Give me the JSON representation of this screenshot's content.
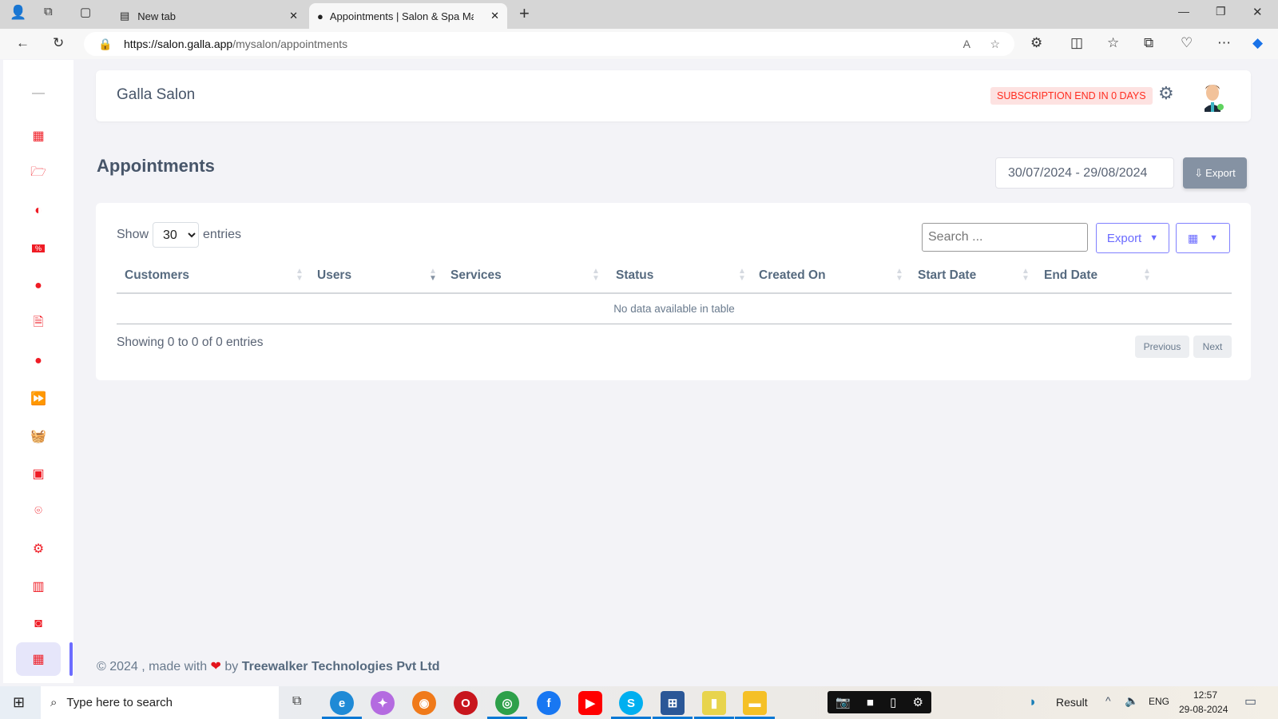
{
  "browser": {
    "tabs": [
      {
        "label": "New tab"
      },
      {
        "label": "Appointments | Salon & Spa Man"
      }
    ],
    "url_host": "https://salon.galla.app",
    "url_path": "/mysalon/appointments"
  },
  "sidebar": {
    "items": [
      {
        "icon": "dashboard-icon"
      },
      {
        "icon": "folder-icon"
      },
      {
        "icon": "contrast-icon"
      },
      {
        "icon": "coupon-icon"
      },
      {
        "icon": "user-circle-icon"
      },
      {
        "icon": "document-icon"
      },
      {
        "icon": "user-circle-icon"
      },
      {
        "icon": "fast-forward-icon"
      },
      {
        "icon": "basket-icon"
      },
      {
        "icon": "contacts-icon"
      },
      {
        "icon": "location-icon"
      },
      {
        "icon": "gear-icon"
      },
      {
        "icon": "report-icon"
      },
      {
        "icon": "money-icon"
      },
      {
        "icon": "calendar-icon",
        "active": true
      }
    ],
    "accent": "#ef1c25"
  },
  "header": {
    "brand": "Galla Salon",
    "subscription_badge": "SUBSCRIPTION END IN 0 DAYS"
  },
  "page": {
    "title": "Appointments",
    "date_range": "30/07/2024 - 29/08/2024",
    "export_label": "Export"
  },
  "table": {
    "show_label": "Show",
    "entries_label": "entries",
    "page_size": "30",
    "search_placeholder": "Search ...",
    "export_dropdown": "Export",
    "columns": [
      "Customers",
      "Users",
      "Services",
      "Status",
      "Created On",
      "Start Date",
      "End Date"
    ],
    "empty_message": "No data available in table",
    "info": "Showing 0 to 0 of 0 entries",
    "prev": "Previous",
    "next": "Next"
  },
  "footer": {
    "prefix": "© 2024 , made with",
    "by": "by",
    "company": "Treewalker Technologies Pvt Ltd"
  },
  "taskbar": {
    "search_placeholder": "Type here to search",
    "weather": "Result",
    "lang": "ENG",
    "time": "12:57",
    "date": "29-08-2024"
  }
}
